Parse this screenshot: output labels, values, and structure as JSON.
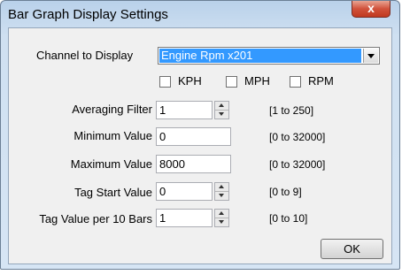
{
  "window": {
    "title": "Bar Graph Display Settings",
    "close_glyph": "x"
  },
  "channel": {
    "label": "Channel to Display",
    "selected": "Engine Rpm x201"
  },
  "units": [
    {
      "label": "KPH",
      "checked": false
    },
    {
      "label": "MPH",
      "checked": false
    },
    {
      "label": "RPM",
      "checked": false
    }
  ],
  "fields": [
    {
      "label": "Averaging Filter",
      "value": "1",
      "range": "[1 to 250]",
      "spinner": true
    },
    {
      "label": "Minimum Value",
      "value": "0",
      "range": "[0 to 32000]",
      "spinner": false
    },
    {
      "label": "Maximum Value",
      "value": "8000",
      "range": "[0 to 32000]",
      "spinner": false
    },
    {
      "label": "Tag Start Value",
      "value": "0",
      "range": "[0 to 9]",
      "spinner": true
    },
    {
      "label": "Tag Value per 10 Bars",
      "value": "1",
      "range": "[0 to 10]",
      "spinner": true
    }
  ],
  "ok_label": "OK"
}
